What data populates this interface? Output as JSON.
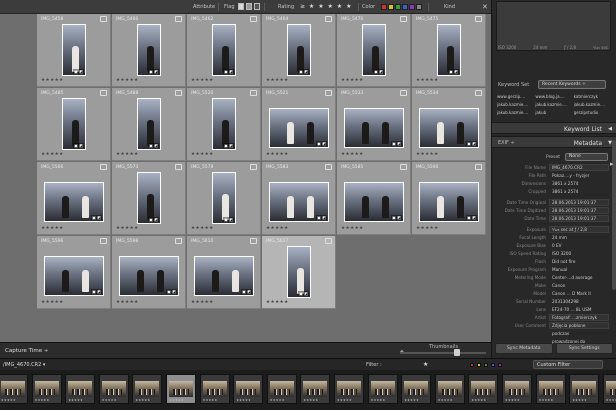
{
  "filter_bar": {
    "attribute_label": "Attribute",
    "flag_label": "Flag",
    "rating_label": "Rating",
    "rating_stars": "≥ ★ ★ ★ ★ ★",
    "color_label": "Color",
    "kind_label": "Kind",
    "color_swatches": [
      "#c9342c",
      "#d8c22a",
      "#3e9a3b",
      "#3c5fc9",
      "#8a3bb0",
      "#888888"
    ]
  },
  "grid": {
    "cells": [
      {
        "num": "IMG_5458",
        "orient": "portrait",
        "figs": [
          "w"
        ],
        "selected": false,
        "rating": "★★★★★"
      },
      {
        "num": "IMG_5460",
        "orient": "portrait",
        "figs": [
          "d"
        ],
        "selected": false,
        "rating": "★★★★★"
      },
      {
        "num": "IMG_5462",
        "orient": "portrait",
        "figs": [
          "d"
        ],
        "selected": false,
        "rating": "★★★★★"
      },
      {
        "num": "IMG_5464",
        "orient": "portrait",
        "figs": [
          "d"
        ],
        "selected": false,
        "rating": "★★★★★"
      },
      {
        "num": "IMG_5470",
        "orient": "portrait",
        "figs": [
          "d"
        ],
        "selected": false,
        "rating": "★★★★★"
      },
      {
        "num": "IMG_5475",
        "orient": "portrait",
        "figs": [
          "d"
        ],
        "selected": false,
        "rating": "★★★★★"
      },
      {
        "num": "IMG_5485",
        "orient": "portrait",
        "figs": [
          "d"
        ],
        "selected": false,
        "rating": "★★★★★"
      },
      {
        "num": "IMG_5488",
        "orient": "portrait",
        "figs": [
          "d"
        ],
        "selected": false,
        "rating": "★★★★★"
      },
      {
        "num": "IMG_5520",
        "orient": "portrait",
        "figs": [
          "d"
        ],
        "selected": false,
        "rating": "★★★★★"
      },
      {
        "num": "IMG_5521",
        "orient": "landscape",
        "figs": [
          "w",
          "d"
        ],
        "selected": false,
        "rating": "★★★★★"
      },
      {
        "num": "IMG_5533",
        "orient": "landscape",
        "figs": [
          "d",
          "d"
        ],
        "selected": false,
        "rating": "★★★★★"
      },
      {
        "num": "IMG_5534",
        "orient": "landscape",
        "figs": [
          "w",
          "d"
        ],
        "selected": false,
        "rating": "★★★★★"
      },
      {
        "num": "IMG_5566",
        "orient": "landscape",
        "figs": [
          "d",
          "w"
        ],
        "selected": false,
        "rating": "★★★★★"
      },
      {
        "num": "IMG_5573",
        "orient": "portrait",
        "figs": [
          "d"
        ],
        "selected": false,
        "rating": "★★★★★"
      },
      {
        "num": "IMG_5578",
        "orient": "portrait",
        "figs": [
          "w"
        ],
        "selected": false,
        "rating": "★★★★★"
      },
      {
        "num": "IMG_5583",
        "orient": "landscape",
        "figs": [
          "w",
          "w"
        ],
        "selected": false,
        "rating": "★★★★★"
      },
      {
        "num": "IMG_5585",
        "orient": "landscape",
        "figs": [
          "d",
          "d"
        ],
        "selected": false,
        "rating": "★★★★★"
      },
      {
        "num": "IMG_5590",
        "orient": "landscape",
        "figs": [
          "w",
          "d"
        ],
        "selected": false,
        "rating": "★★★★★"
      },
      {
        "num": "IMG_5596",
        "orient": "landscape",
        "figs": [
          "d",
          "w"
        ],
        "selected": false,
        "rating": "★★★★★"
      },
      {
        "num": "IMG_5598",
        "orient": "landscape",
        "figs": [
          "d",
          "d"
        ],
        "selected": false,
        "rating": "★★★★★"
      },
      {
        "num": "IMG_5610",
        "orient": "landscape",
        "figs": [
          "d",
          "w"
        ],
        "selected": false,
        "rating": "★★★★★"
      },
      {
        "num": "IMG_5617",
        "orient": "portrait",
        "figs": [
          "w"
        ],
        "selected": true,
        "rating": "★★★★★"
      }
    ]
  },
  "toolbar": {
    "sort_label": "Capture Time ÷",
    "thumbnails_label": "Thumbnails"
  },
  "right_panel": {
    "histogram_info": [
      "ISO 3200",
      "24 mm",
      "ƒ / 2,8",
      "¹⁄₁₂₅ sec"
    ],
    "keyword_set_label": "Keyword Set",
    "keyword_set_value": "Recent Keywords ÷",
    "keywords": [
      "www.gerzip....",
      "www.blog.ja....",
      "katmierczyk",
      "jakub.kazmie....",
      "jakub.kazmie....",
      "jakub.kazmie....",
      "jakub.kazmie....",
      "jakub",
      "gerzipstudio"
    ],
    "keyword_list_label": "Keyword List",
    "metadata_left": "EXIF ÷",
    "metadata_label": "Metadata",
    "preset_label": "Preset",
    "preset_value": "None",
    "metadata": [
      {
        "k": "File Name",
        "v": "IMG_4670.CR2",
        "box": true
      },
      {
        "k": "File Path",
        "v": "Pokaz....y - fryzjer",
        "box": false
      },
      {
        "k": "Dimensions",
        "v": "3861 x 2574",
        "box": false
      },
      {
        "k": "Cropped",
        "v": "3861 x 2574",
        "box": false
      },
      {
        "k": "Date Time Original",
        "v": "28.06.2013 19:01:37",
        "box": true
      },
      {
        "k": "Date Time Digitized",
        "v": "28.06.2013 19:01:37",
        "box": true
      },
      {
        "k": "Date Time",
        "v": "28.06.2013 19:01:37",
        "box": true
      },
      {
        "k": "Exposure",
        "v": "¹⁄₁₂₅ sec at ƒ / 2,8",
        "box": true
      },
      {
        "k": "Focal Length",
        "v": "24 mm",
        "box": false
      },
      {
        "k": "Exposure Bias",
        "v": "0 EV",
        "box": false
      },
      {
        "k": "ISO Speed Rating",
        "v": "ISO 3200",
        "box": false
      },
      {
        "k": "Flash",
        "v": "Did not fire",
        "box": false
      },
      {
        "k": "Exposure Program",
        "v": "Manual",
        "box": false
      },
      {
        "k": "Metering Mode",
        "v": "Center-...d average",
        "box": false
      },
      {
        "k": "Make",
        "v": "Canon",
        "box": false
      },
      {
        "k": "Model",
        "v": "Canon ... D Mark II",
        "box": false
      },
      {
        "k": "Serial Number",
        "v": "2031304298",
        "box": false
      },
      {
        "k": "Lens",
        "v": "EF24-70 ... 8L USM",
        "box": false
      },
      {
        "k": "Artist",
        "v": "Fotograf: ...zmierczyk",
        "box": true
      },
      {
        "k": "User Comment",
        "v": "Zdjęcia poblone",
        "box": true
      },
      {
        "k": "",
        "v": "podczas",
        "box": false
      },
      {
        "k": "",
        "v": "prowadzonej do",
        "box": false
      }
    ],
    "sync_metadata": "Sync Metadata",
    "sync_settings": "Sync Settings"
  },
  "filmstrip": {
    "path": "/IMG_4670.CR2 ▾",
    "filter_label": "Filter :",
    "stars": "★",
    "swatches": [
      "#c9342c",
      "#d8c22a",
      "#3e9a3b",
      "#3c5fc9",
      "#8a3bb0"
    ],
    "custom_filter": "Custom Filter",
    "thumb_count": 20,
    "selected_index": 5,
    "thumb_dots": "★★★★★"
  }
}
